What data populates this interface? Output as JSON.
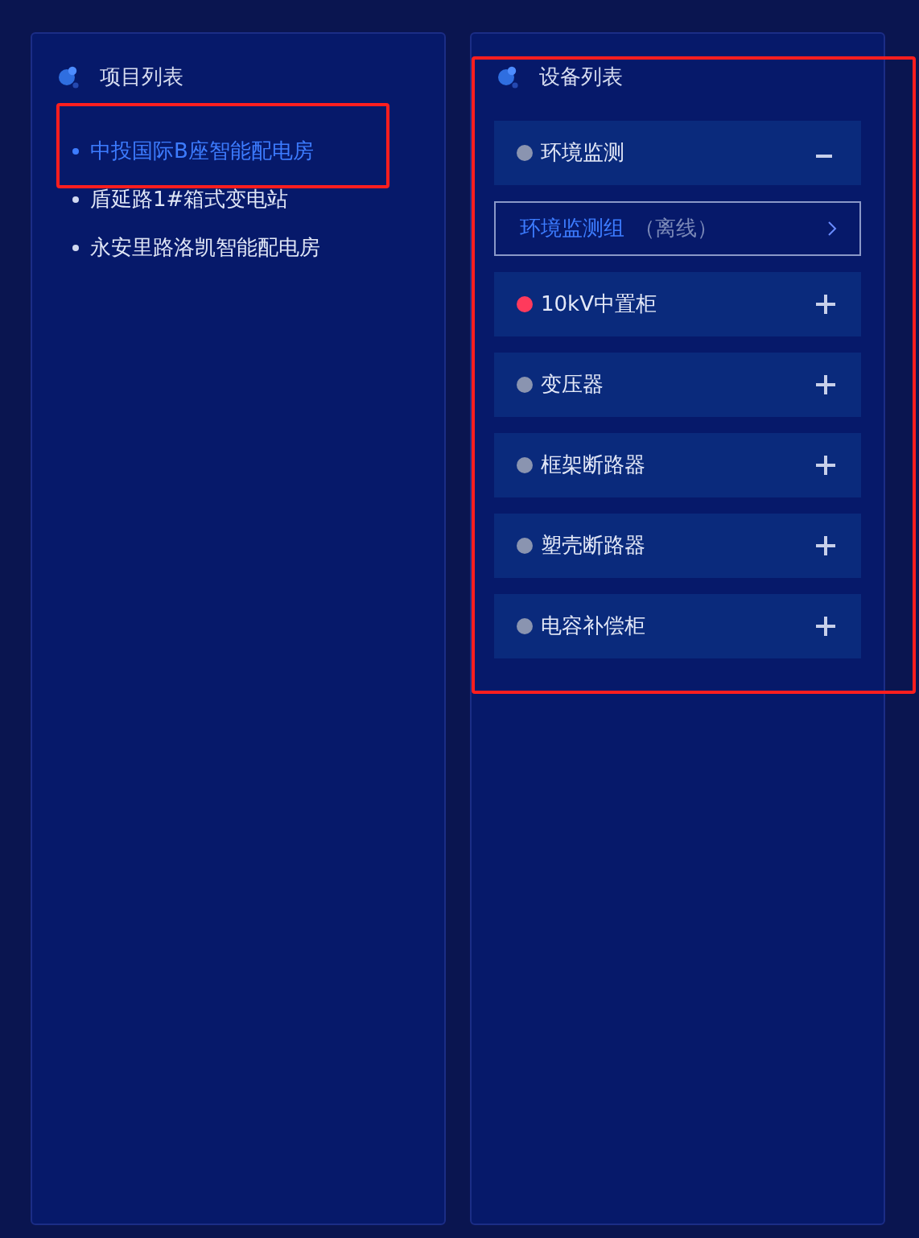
{
  "projects": {
    "title": "项目列表",
    "items": [
      {
        "label": "中投国际B座智能配电房",
        "selected": true,
        "highlighted": true
      },
      {
        "label": "盾延路1#箱式变电站",
        "selected": false,
        "highlighted": false
      },
      {
        "label": "永安里路洛凯智能配电房",
        "selected": false,
        "highlighted": false
      }
    ]
  },
  "devices": {
    "title": "设备列表",
    "highlighted": true,
    "groups": [
      {
        "label": "环境监测",
        "color": "#8a94b0",
        "expanded": true,
        "children": [
          {
            "label": "环境监测组",
            "status": "（离线）"
          }
        ]
      },
      {
        "label": "10kV中置柜",
        "color": "#ff3a5c",
        "expanded": false
      },
      {
        "label": "变压器",
        "color": "#8a94b0",
        "expanded": false
      },
      {
        "label": "框架断路器",
        "color": "#8a94b0",
        "expanded": false
      },
      {
        "label": "塑壳断路器",
        "color": "#8a94b0",
        "expanded": false
      },
      {
        "label": "电容补偿柜",
        "color": "#8a94b0",
        "expanded": false
      }
    ]
  }
}
